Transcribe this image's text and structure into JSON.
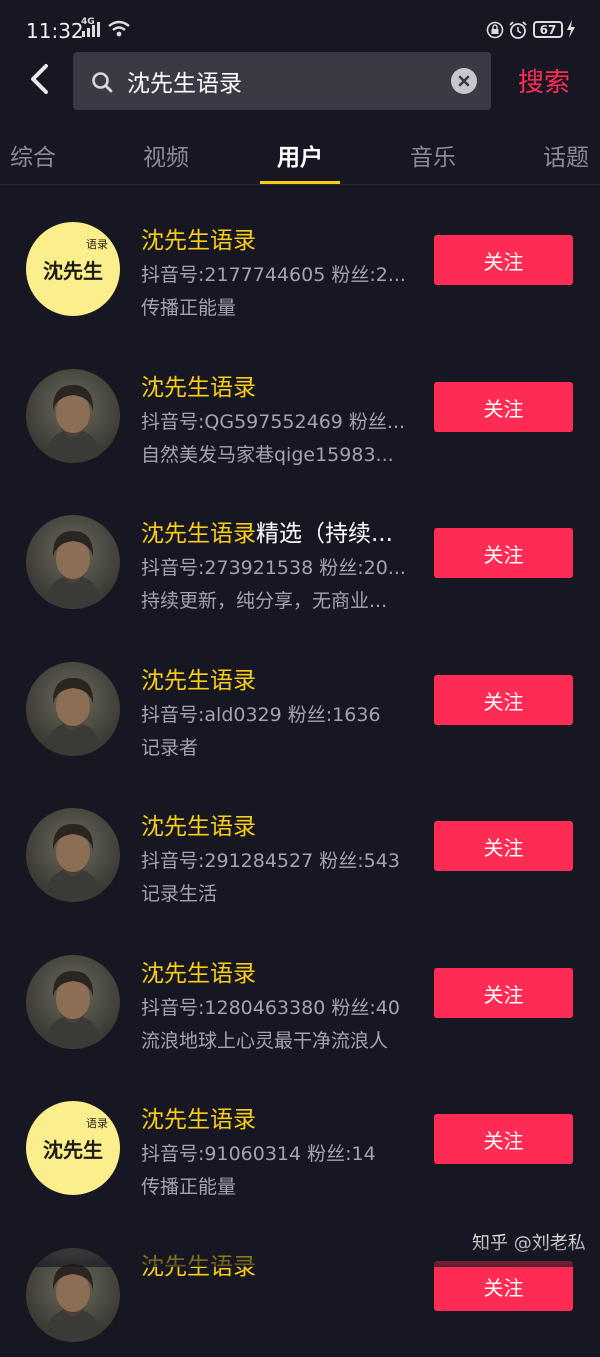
{
  "status_bar": {
    "time": "11:32",
    "network": "4G",
    "battery": "67"
  },
  "search": {
    "query": "沈先生语录",
    "action_label": "搜索"
  },
  "tabs": [
    {
      "label": "综合",
      "active": false
    },
    {
      "label": "视频",
      "active": false
    },
    {
      "label": "用户",
      "active": true
    },
    {
      "label": "音乐",
      "active": false
    },
    {
      "label": "话题",
      "active": false
    }
  ],
  "users": [
    {
      "name_highlight": "沈先生语录",
      "name_rest": "",
      "meta": "抖音号:2177744605 粉丝:2...",
      "bio": "传播正能量",
      "follow_label": "关注",
      "avatar": "logo-avatar"
    },
    {
      "name_highlight": "沈先生语录",
      "name_rest": "",
      "meta": "抖音号:QG597552469 粉丝...",
      "bio": "自然美发马家巷qige15983...",
      "follow_label": "关注",
      "avatar": "photo-avatar"
    },
    {
      "name_highlight": "沈先生语录",
      "name_rest": "精选（持续...",
      "meta": "抖音号:273921538 粉丝:20...",
      "bio": "持续更新，纯分享，无商业...",
      "follow_label": "关注",
      "avatar": "photo-avatar"
    },
    {
      "name_highlight": "沈先生语录",
      "name_rest": "",
      "meta": "抖音号:ald0329 粉丝:1636",
      "bio": "记录者",
      "follow_label": "关注",
      "avatar": "photo-avatar"
    },
    {
      "name_highlight": "沈先生语录",
      "name_rest": "",
      "meta": "抖音号:291284527 粉丝:543",
      "bio": "记录生活",
      "follow_label": "关注",
      "avatar": "photo-avatar"
    },
    {
      "name_highlight": "沈先生语录",
      "name_rest": "",
      "meta": "抖音号:1280463380 粉丝:40",
      "bio": "流浪地球上心灵最干净流浪人",
      "follow_label": "关注",
      "avatar": "photo-avatar"
    },
    {
      "name_highlight": "沈先生语录",
      "name_rest": "",
      "meta": "抖音号:91060314 粉丝:14",
      "bio": "传播正能量",
      "follow_label": "关注",
      "avatar": "logo-avatar"
    },
    {
      "name_highlight": "沈先生语录",
      "name_rest": "",
      "meta": "",
      "bio": "",
      "follow_label": "关注",
      "avatar": "photo-avatar"
    }
  ],
  "logo_avatar": {
    "big_text": "沈先生",
    "small_text": "语录"
  },
  "watermark": "知乎 @刘老私",
  "colors": {
    "background": "#161723",
    "accent": "#fe2c55",
    "highlight": "#face15"
  }
}
